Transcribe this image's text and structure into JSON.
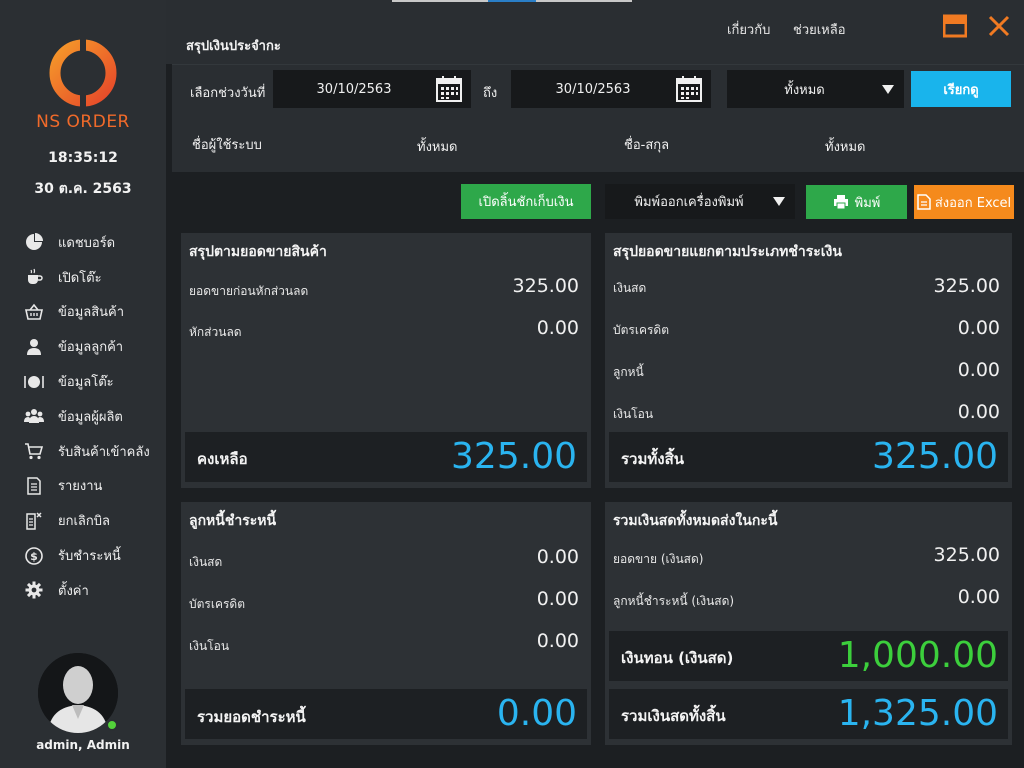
{
  "sidebar": {
    "brand": "NS ORDER",
    "time": "18:35:12",
    "date": "30 ต.ค. 2563",
    "items": [
      {
        "label": "แดชบอร์ด",
        "icon": "pie-chart-icon"
      },
      {
        "label": "เปิดโต๊ะ",
        "icon": "coffee-cup-icon"
      },
      {
        "label": "ข้อมูลสินค้า",
        "icon": "basket-icon"
      },
      {
        "label": "ข้อมูลลูกค้า",
        "icon": "user-icon"
      },
      {
        "label": "ข้อมูลโต๊ะ",
        "icon": "plate-icon"
      },
      {
        "label": "ข้อมูลผู้ผลิต",
        "icon": "group-icon"
      },
      {
        "label": "รับสินค้าเข้าคลัง",
        "icon": "cart-icon"
      },
      {
        "label": "รายงาน",
        "icon": "document-icon"
      },
      {
        "label": "ยกเลิกบิล",
        "icon": "cancel-doc-icon"
      },
      {
        "label": "รับชำระหนี้",
        "icon": "dollar-coin-icon"
      },
      {
        "label": "ตั้งค่า",
        "icon": "gear-icon"
      }
    ],
    "user": "admin, Admin"
  },
  "header": {
    "title": "สรุปเงินประจำกะ",
    "about": "เกี่ยวกับ",
    "help": "ช่วยเหลือ",
    "accent": "#f07a22"
  },
  "filters": {
    "range_label": "เลือกช่วงวันที่",
    "date_from": "30/10/2563",
    "to_label": "ถึง",
    "date_to": "30/10/2563",
    "scope": "ทั้งหมด",
    "query_button": "เรียกดู",
    "system_user_label": "ชื่อผู้ใช้ระบบ",
    "system_user_value": "ทั้งหมด",
    "fullname_label": "ชื่อ-สกุล",
    "fullname_value": "ทั้งหมด"
  },
  "actions": {
    "open_drawer": "เปิดลิ้นชักเก็บเงิน",
    "printer_select": "พิมพ์ออกเครื่องพิมพ์",
    "print": "พิมพ์",
    "export_excel": "ส่งออก Excel"
  },
  "sales_summary": {
    "title": "สรุปตามยอดขายสินค้า",
    "rows": [
      {
        "label": "ยอดขายก่อนหักส่วนลด",
        "value": "325.00"
      },
      {
        "label": "หักส่วนลด",
        "value": "0.00"
      }
    ],
    "total_label": "คงเหลือ",
    "total_value": "325.00"
  },
  "payment_summary": {
    "title": "สรุปยอดขายแยกตามประเภทชำระเงิน",
    "rows": [
      {
        "label": "เงินสด",
        "value": "325.00"
      },
      {
        "label": "บัตรเครดิต",
        "value": "0.00"
      },
      {
        "label": "ลูกหนี้",
        "value": "0.00"
      },
      {
        "label": "เงินโอน",
        "value": "0.00"
      }
    ],
    "total_label": "รวมทั้งสิ้น",
    "total_value": "325.00"
  },
  "debt_payment": {
    "title": "ลูกหนี้ชำระหนี้",
    "rows": [
      {
        "label": "เงินสด",
        "value": "0.00"
      },
      {
        "label": "บัตรเครดิต",
        "value": "0.00"
      },
      {
        "label": "เงินโอน",
        "value": "0.00"
      }
    ],
    "total_label": "รวมยอดชำระหนี้",
    "total_value": "0.00"
  },
  "cash_total": {
    "title": "รวมเงินสดทั้งหมดส่งในกะนี้",
    "rows": [
      {
        "label": "ยอดขาย (เงินสด)",
        "value": "325.00"
      },
      {
        "label": "ลูกหนี้ชำระหนี้ (เงินสด)",
        "value": "0.00"
      }
    ],
    "change_label": "เงินทอน (เงินสด)",
    "change_value": "1,000.00",
    "total_label": "รวมเงินสดทั้งสิ้น",
    "total_value": "1,325.00"
  }
}
